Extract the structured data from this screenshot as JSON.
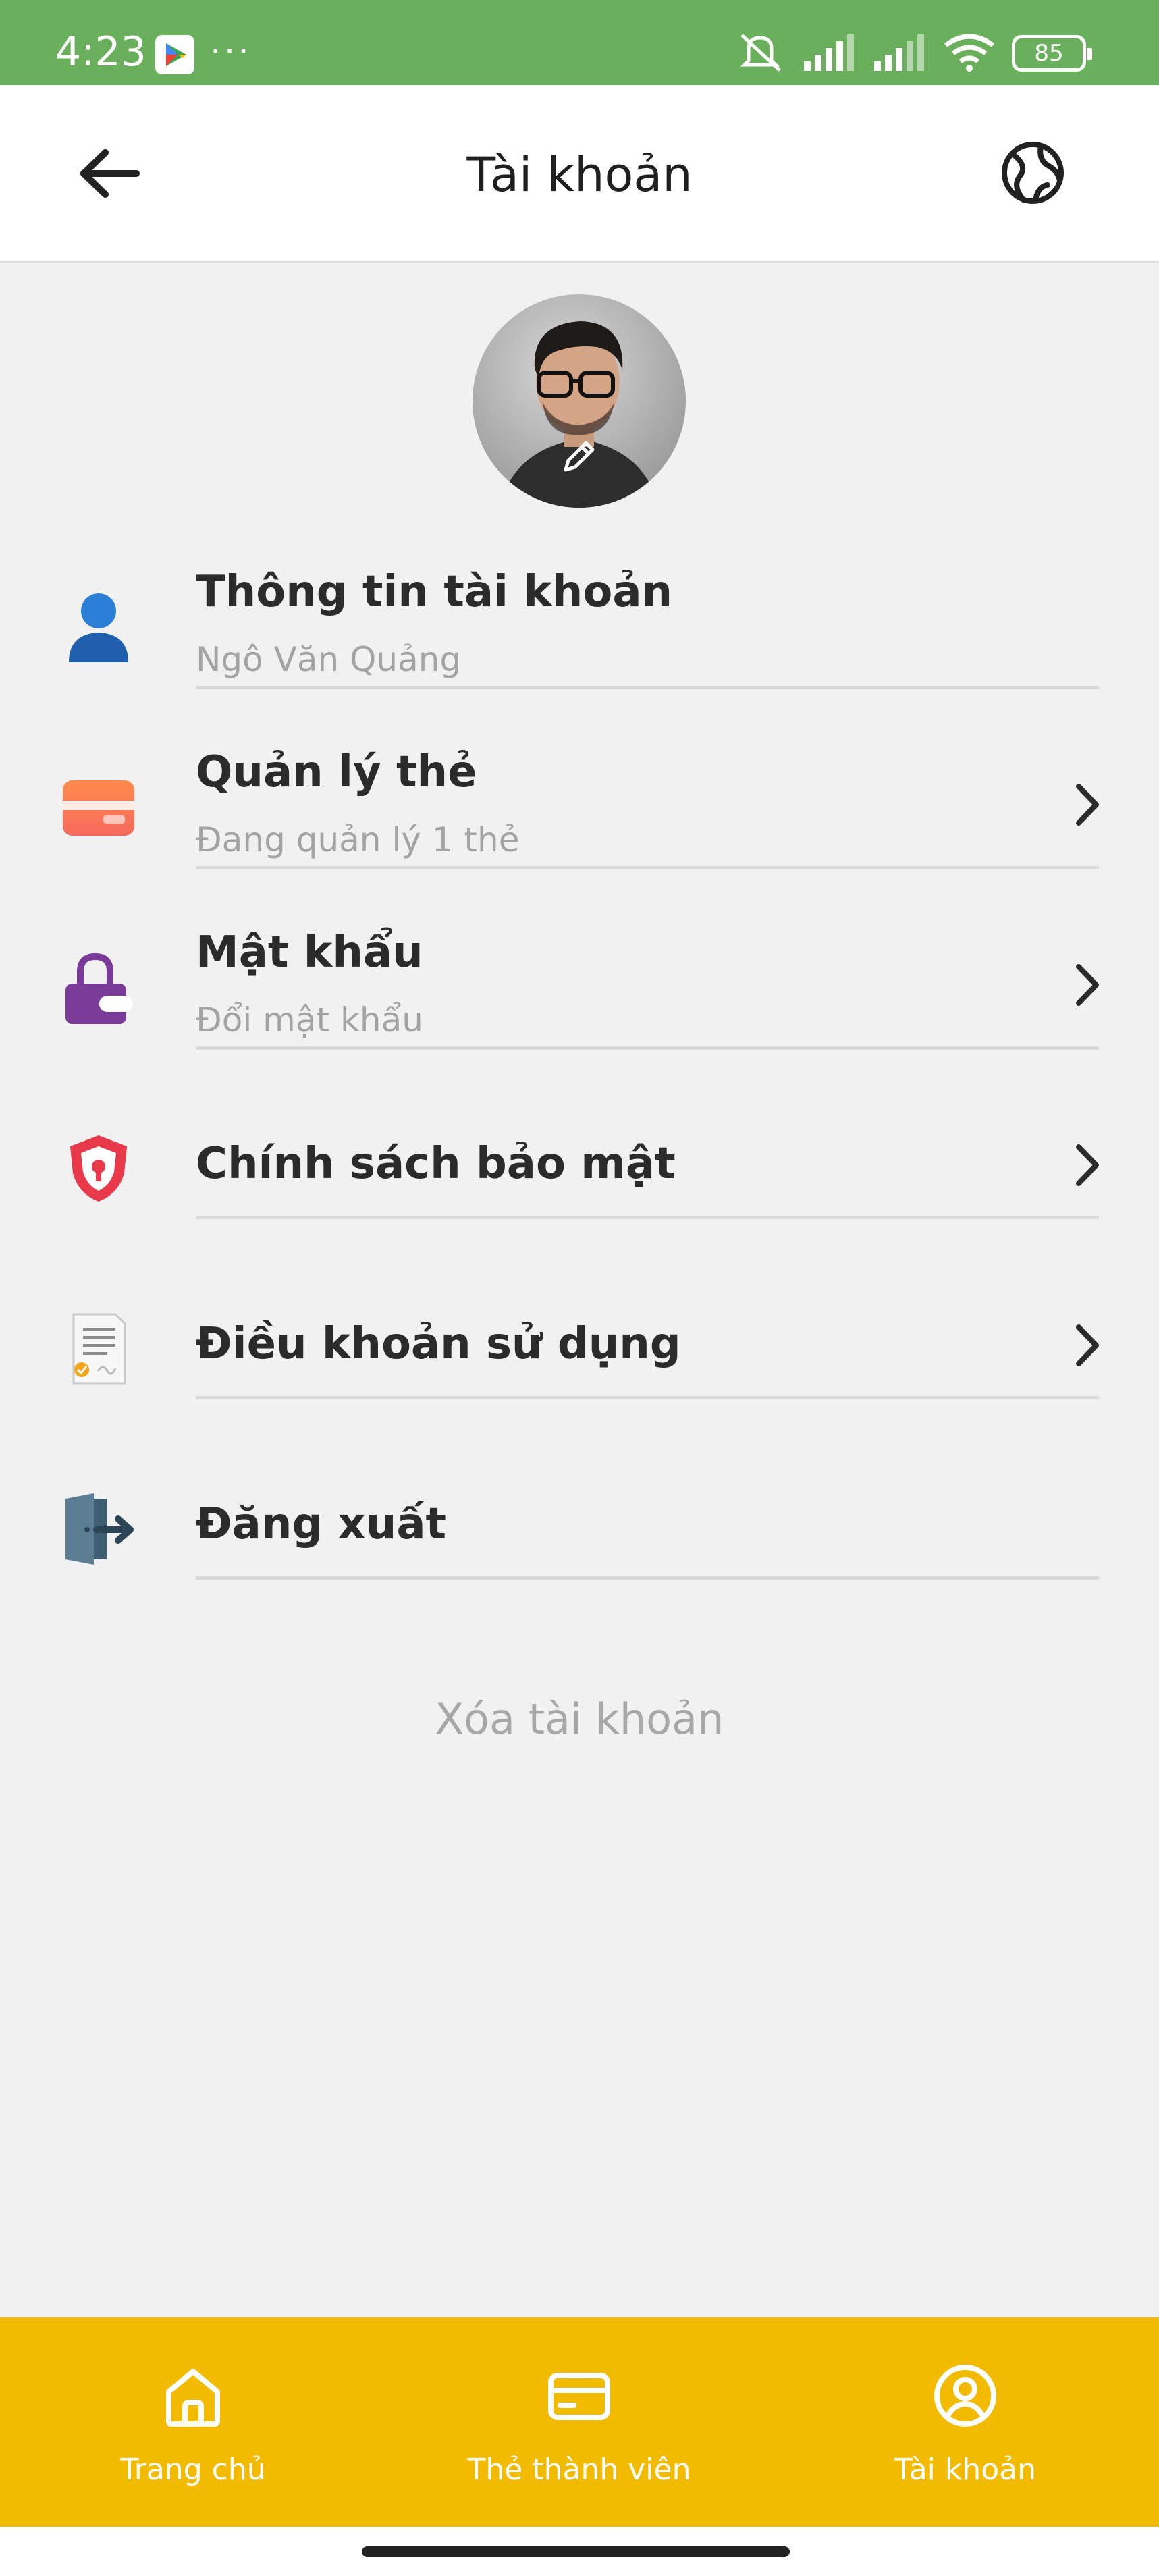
{
  "status_bar": {
    "time": "4:23",
    "dots": "···",
    "battery": "85"
  },
  "header": {
    "title": "Tài khoản"
  },
  "menu": [
    {
      "title": "Thông tin tài khoản",
      "subtitle": "Ngô Văn Quảng",
      "icon": "user-icon"
    },
    {
      "title": "Quản lý thẻ",
      "subtitle": "Đang quản lý 1 thẻ",
      "icon": "card-icon"
    },
    {
      "title": "Mật khẩu",
      "subtitle": "Đổi mật khẩu",
      "icon": "lock-icon"
    },
    {
      "title": "Chính sách bảo mật",
      "icon": "shield-icon"
    },
    {
      "title": "Điều khoản sử dụng",
      "icon": "document-icon"
    },
    {
      "title": "Đăng xuất",
      "icon": "logout-icon"
    }
  ],
  "delete_account": "Xóa tài khoản",
  "bottom_nav": [
    {
      "label": "Trang chủ",
      "icon": "home-icon"
    },
    {
      "label": "Thẻ thành viên",
      "icon": "member-card-icon"
    },
    {
      "label": "Tài khoản",
      "icon": "account-icon"
    }
  ],
  "colors": {
    "status_bar": "#6aaf5c",
    "nav_bar": "#f3bb00",
    "background": "#f1f1f1"
  }
}
